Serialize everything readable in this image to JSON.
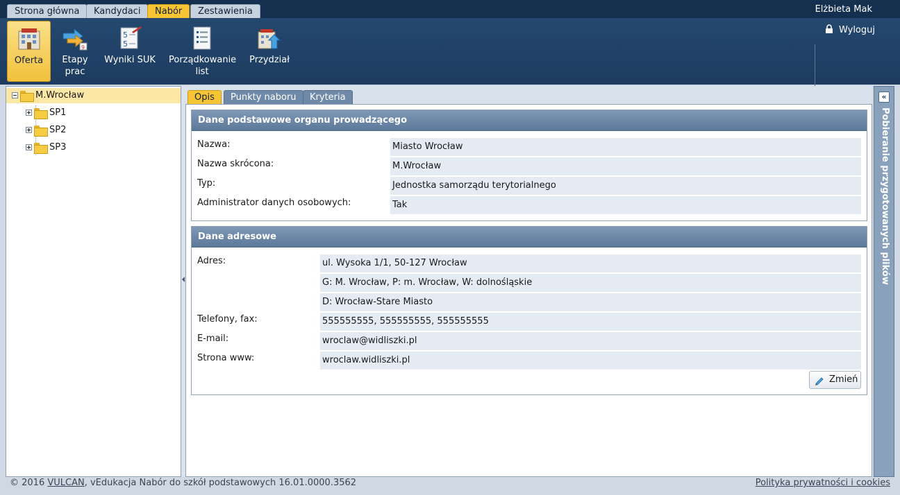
{
  "header": {
    "tabs": [
      "Strona główna",
      "Kandydaci",
      "Nabór",
      "Zestawienia"
    ],
    "active_tab": "Nabór",
    "user_name": "Elżbieta Mak",
    "logout_label": "Wyloguj"
  },
  "toolbar": {
    "buttons": [
      {
        "label": "Oferta",
        "icon": "building-icon",
        "active": true
      },
      {
        "label": "Etapy prac",
        "icon": "stages-arrow-icon",
        "active": false
      },
      {
        "label": "Wyniki SUK",
        "icon": "results-icon",
        "active": false
      },
      {
        "label": "Porządkowanie list",
        "icon": "list-icon",
        "active": false
      },
      {
        "label": "Przydział",
        "icon": "assign-icon",
        "active": false
      }
    ]
  },
  "tree": {
    "root": "M.Wrocław",
    "children": [
      "SP1",
      "SP2",
      "SP3"
    ]
  },
  "subtabs": [
    "Opis",
    "Punkty naboru",
    "Kryteria"
  ],
  "active_subtab": "Opis",
  "section1": {
    "title": "Dane podstawowe organu prowadzącego",
    "fields": [
      {
        "label": "Nazwa:",
        "value": "Miasto Wrocław"
      },
      {
        "label": "Nazwa skrócona:",
        "value": "M.Wrocław"
      },
      {
        "label": "Typ:",
        "value": "Jednostka samorządu terytorialnego"
      },
      {
        "label": "Administrator danych osobowych:",
        "value": "Tak"
      }
    ]
  },
  "section2": {
    "title": "Dane adresowe",
    "address_label": "Adres:",
    "address_lines": [
      "ul. Wysoka 1/1, 50-127 Wrocław",
      "G: M. Wrocław, P: m. Wrocław, W: dolnośląskie",
      "D: Wrocław-Stare Miasto"
    ],
    "fields": [
      {
        "label": "Telefony, fax:",
        "value": "555555555, 555555555, 555555555"
      },
      {
        "label": "E-mail:",
        "value": "wroclaw@widliszki.pl"
      },
      {
        "label": "Strona www:",
        "value": "wroclaw.widliszki.pl"
      }
    ],
    "edit_button": "Zmień"
  },
  "right_panel": {
    "title": "Pobieranie przygotowanych plików"
  },
  "footer": {
    "copyright_prefix": "© 2016 ",
    "vendor": "VULCAN",
    "product": ", vEdukacja Nabór do szkół podstawowych 16.01.0000.3562",
    "privacy_link": "Polityka prywatności i cookies"
  }
}
